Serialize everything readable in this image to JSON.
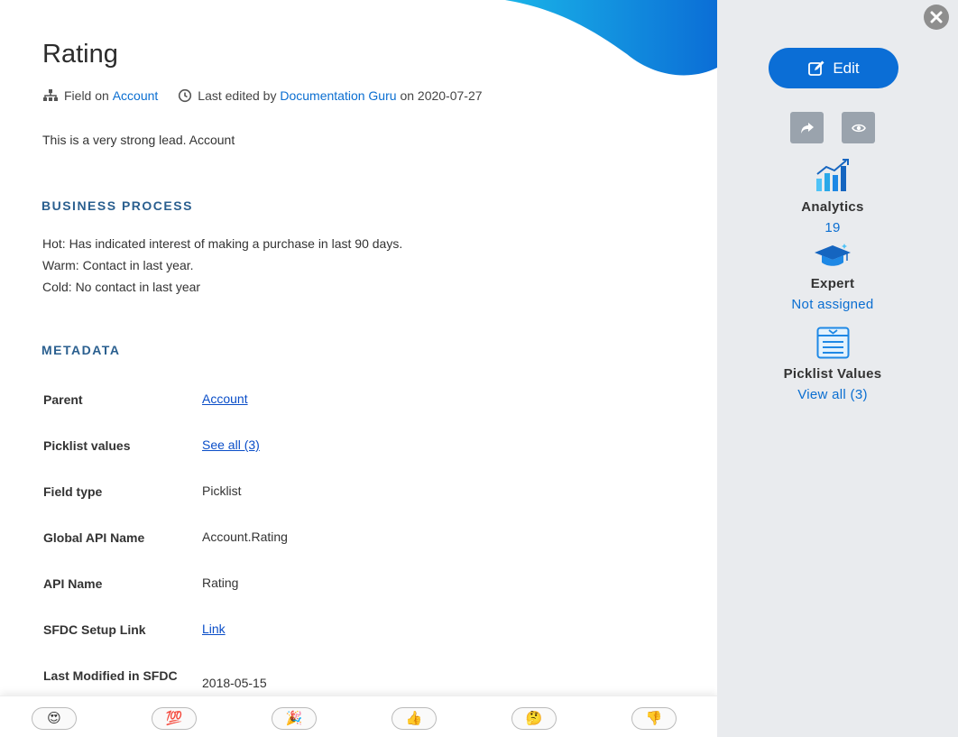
{
  "header": {
    "title": "Rating",
    "field_on_prefix": "Field on",
    "field_on_object": "Account",
    "last_edited_prefix": "Last edited by",
    "last_edited_user": "Documentation Guru",
    "last_edited_on": "on",
    "last_edited_date": "2020-07-27"
  },
  "description": "This is a very strong lead. Account",
  "business_process": {
    "heading": "BUSINESS PROCESS",
    "lines": [
      "Hot: Has indicated interest of making a purchase in last 90 days.",
      "Warm: Contact in last year.",
      "Cold: No contact in last year"
    ]
  },
  "metadata": {
    "heading": "METADATA",
    "rows": [
      {
        "label": "Parent",
        "value": "Account",
        "is_link": true
      },
      {
        "label": "Picklist values",
        "value": "See all (3)",
        "is_link": true
      },
      {
        "label": "Field type",
        "value": "Picklist",
        "is_link": false
      },
      {
        "label": "Global API Name",
        "value": "Account.Rating",
        "is_link": false
      },
      {
        "label": "API Name",
        "value": "Rating",
        "is_link": false
      },
      {
        "label": "SFDC Setup Link",
        "value": "Link",
        "is_link": true
      },
      {
        "label": "Last Modified in SFDC",
        "value": "2018-05-15",
        "is_link": false
      }
    ]
  },
  "reactions": [
    {
      "name": "heart-eyes",
      "glyph": "😍"
    },
    {
      "name": "hundred",
      "glyph": "💯"
    },
    {
      "name": "party-popper",
      "glyph": "🎉"
    },
    {
      "name": "thumbs-up",
      "glyph": "👍"
    },
    {
      "name": "thinking",
      "glyph": "🤔"
    },
    {
      "name": "thumbs-down",
      "glyph": "👎"
    }
  ],
  "sidebar": {
    "edit_label": "Edit",
    "analytics_label": "Analytics",
    "analytics_value": "19",
    "expert_label": "Expert",
    "expert_value": "Not assigned",
    "picklist_label": "Picklist Values",
    "picklist_value": "View all (3)"
  },
  "colors": {
    "accent": "#0b6ed6",
    "link": "#0a6ed1",
    "section_heading": "#2a5f8f",
    "sidebar_bg": "#e9ebee"
  }
}
